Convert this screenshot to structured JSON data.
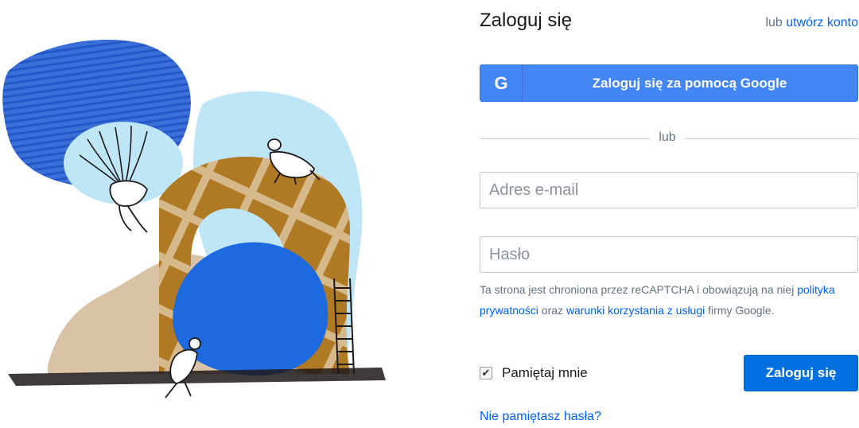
{
  "header": {
    "title": "Zaloguj się",
    "alt_prefix": "lub",
    "create_account_link": "utwórz konto"
  },
  "google_button": {
    "icon": "G",
    "label": "Zaloguj się za pomocą Google"
  },
  "divider": {
    "text": "lub"
  },
  "email_field": {
    "placeholder": "Adres e-mail",
    "value": ""
  },
  "password_field": {
    "placeholder": "Hasło",
    "value": ""
  },
  "recaptcha": {
    "text_1": "Ta strona jest chroniona przez reCAPTCHA i obowiązują na niej ",
    "privacy_link": "polityka prywatności",
    "text_2": " oraz ",
    "terms_link": "warunki korzystania z usługi",
    "text_3": " firmy Google."
  },
  "remember_me": {
    "label": "Pamiętaj mnie",
    "checked": true,
    "check_glyph": "✔"
  },
  "login_button": {
    "label": "Zaloguj się"
  },
  "forgot_password_link": "Nie pamiętasz hasła?",
  "colors": {
    "primary": "#0070e0",
    "google": "#4285f4",
    "link": "#0061fe",
    "text": "#1e1919",
    "muted": "#637282"
  }
}
